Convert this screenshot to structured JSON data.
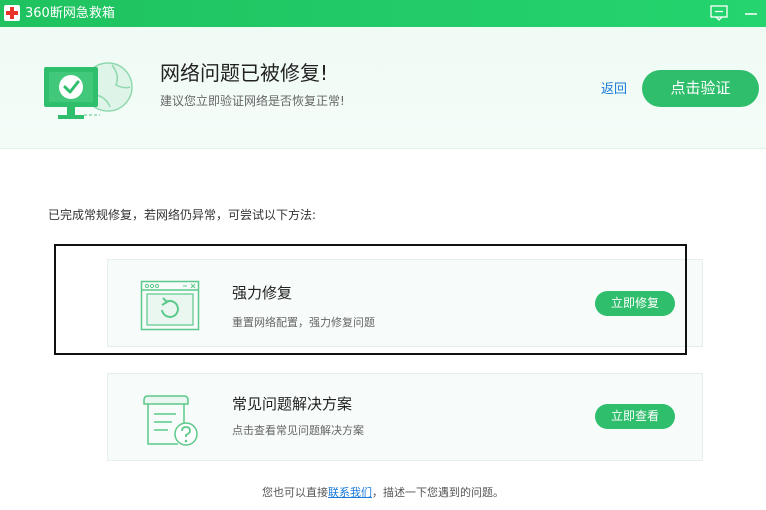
{
  "window": {
    "title": "360断网急救箱"
  },
  "header": {
    "title": "网络问题已被修复!",
    "subtitle": "建议您立即验证网络是否恢复正常!",
    "back_link": "返回",
    "verify_button": "点击验证"
  },
  "main": {
    "intro": "已完成常规修复，若网络仍异常，可尝试以下方法:",
    "cards": [
      {
        "title": "强力修复",
        "description": "重置网络配置，强力修复问题",
        "button": "立即修复"
      },
      {
        "title": "常见问题解决方案",
        "description": "点击查看常见问题解决方案",
        "button": "立即查看"
      }
    ]
  },
  "footer": {
    "prefix": "您也可以直接",
    "link": "联系我们",
    "suffix": "，描述一下您遇到的问题。"
  },
  "colors": {
    "titlebar": "#22cd69",
    "accent": "#2fbe6c",
    "link": "#1a7ad8",
    "header_bg": "#f0fbf5",
    "card_bg": "#f7fbf9"
  },
  "icons": {
    "app": "first-aid-cross-icon",
    "feedback": "message-icon",
    "minimize": "minimize-icon",
    "hero": "computer-check-globe-icon",
    "strong_repair": "window-refresh-icon",
    "faq": "document-question-icon"
  }
}
